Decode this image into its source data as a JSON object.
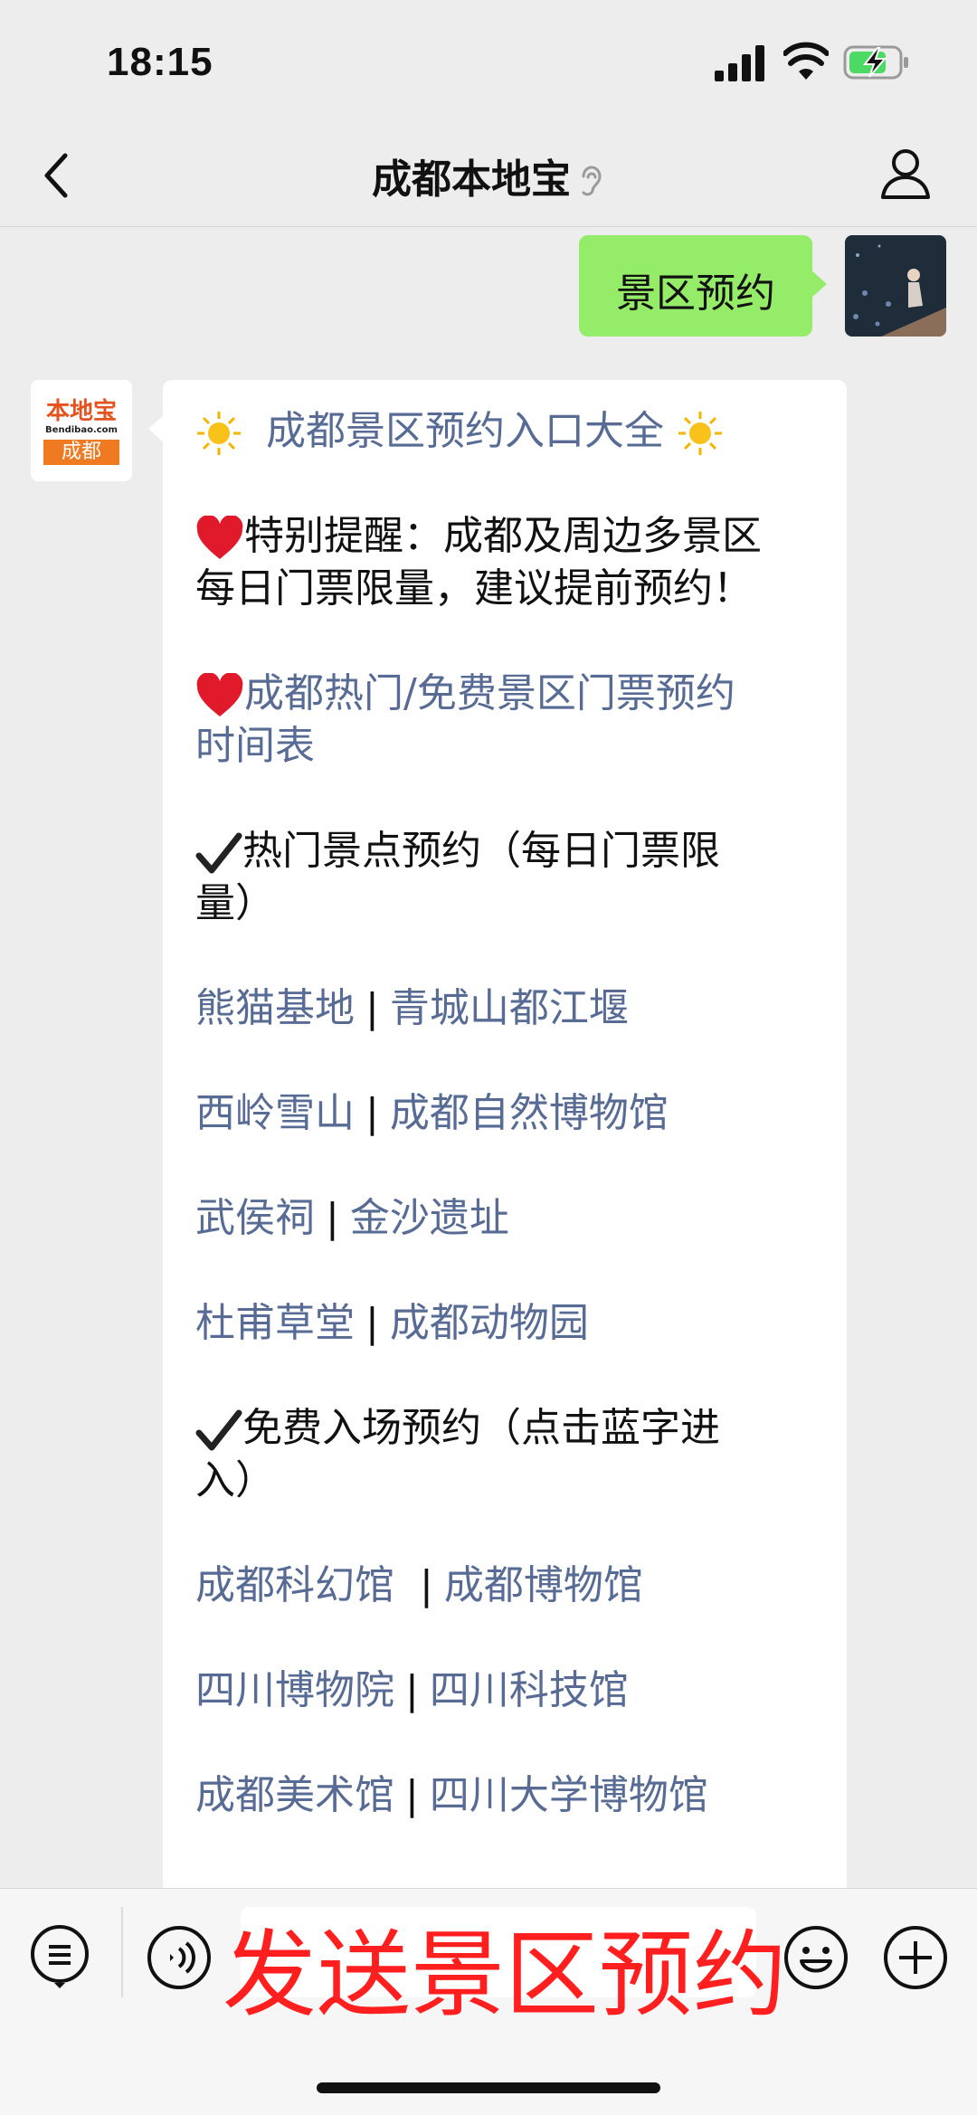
{
  "status_bar": {
    "time": "18:15"
  },
  "nav": {
    "title": "成都本地宝"
  },
  "chat": {
    "sent_message": "景区预约",
    "bot_avatar": {
      "line1": "本地宝",
      "line2": "Bendibao.com",
      "line3": "成都"
    },
    "reply": {
      "headline": "成都景区预约入口大全",
      "notice": [
        "特别提醒：成都及周边多景区",
        "每日门票限量，建议提前预约！"
      ],
      "timetable_link": [
        "成都热门/免费景区门票预约",
        "时间表"
      ],
      "hot_section": [
        "热门景点预约（每日门票限",
        "量）"
      ],
      "hot_links": [
        [
          "熊猫基地",
          "青城山都江堰"
        ],
        [
          "西岭雪山",
          "成都自然博物馆"
        ],
        [
          "武侯祠",
          "金沙遗址"
        ],
        [
          "杜甫草堂",
          "成都动物园"
        ]
      ],
      "free_section": [
        "免费入场预约（点击蓝字进",
        "入）"
      ],
      "free_links": [
        [
          "成都科幻馆",
          "成都博物馆"
        ],
        [
          "四川博物院",
          "四川科技馆"
        ],
        [
          "成都美术馆",
          "四川大学博物馆"
        ]
      ],
      "separator": "|"
    }
  },
  "overlay_caption": "发送景区预约",
  "colors": {
    "link": "#576b95",
    "sent_bubble": "#95ec69",
    "overlay": "#ff1f1f",
    "background": "#ededed"
  },
  "icons": [
    "signal-icon",
    "wifi-icon",
    "battery-charging-icon",
    "back-icon",
    "ear-icon",
    "person-icon",
    "heart-icon",
    "sun-icon",
    "check-icon",
    "menu-list-icon",
    "voice-icon",
    "emoji-icon",
    "plus-icon"
  ]
}
